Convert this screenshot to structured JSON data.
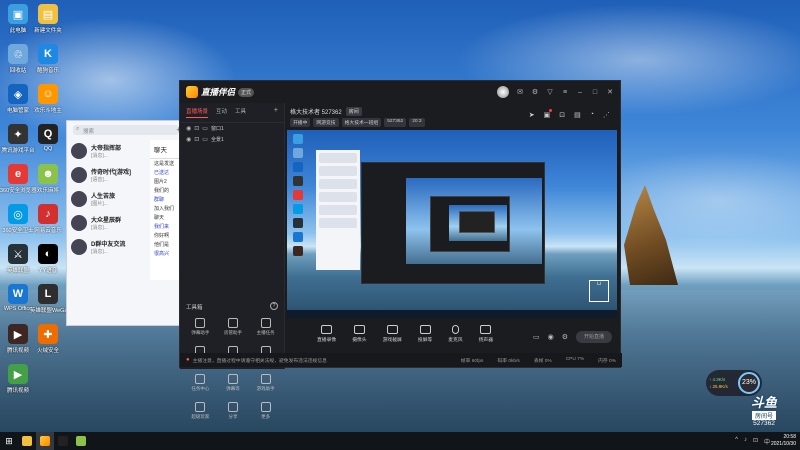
{
  "desktop_icons": [
    {
      "label": "此电脑",
      "color": "#3a9ee0",
      "glyph": "▣"
    },
    {
      "label": "新建文件夹",
      "color": "#f0c040",
      "glyph": "▤"
    },
    {
      "label": "回收站",
      "color": "#6fa8dc",
      "glyph": "♲"
    },
    {
      "label": "酷狗音乐",
      "color": "#1e88e5",
      "glyph": "K"
    },
    {
      "label": "电脑管家",
      "color": "#1565c0",
      "glyph": "◈"
    },
    {
      "label": "欢乐斗地主",
      "color": "#ff9800",
      "glyph": "☺"
    },
    {
      "label": "腾讯游戏平台",
      "color": "#333",
      "glyph": "✦"
    },
    {
      "label": "QQ",
      "color": "#222",
      "glyph": "Q"
    },
    {
      "label": "360安全浏览器",
      "color": "#e53935",
      "glyph": "e"
    },
    {
      "label": "欢乐麻将",
      "color": "#8bc34a",
      "glyph": "☻"
    },
    {
      "label": "360安全卫士",
      "color": "#039be5",
      "glyph": "◎"
    },
    {
      "label": "网易云音乐",
      "color": "#d32f2f",
      "glyph": "♪"
    },
    {
      "label": "英雄联盟",
      "color": "#263238",
      "glyph": "⚔"
    },
    {
      "label": "YY语音",
      "color": "#000",
      "glyph": "◐"
    },
    {
      "label": "WPS Office",
      "color": "#1976d2",
      "glyph": "W"
    },
    {
      "label": "英雄联盟WeGame",
      "color": "#2e2e2e",
      "glyph": "L"
    },
    {
      "label": "腾讯视频",
      "color": "#3e2723",
      "glyph": "▶"
    },
    {
      "label": "火绒安全",
      "color": "#ef6c00",
      "glyph": "✚"
    },
    {
      "label": "腾讯视频",
      "color": "#43a047",
      "glyph": "▶"
    }
  ],
  "chat": {
    "search_placeholder": "搜索",
    "items": [
      {
        "name": "大帝指挥部",
        "msg": "[消息]...",
        "time": "20:53"
      },
      {
        "name": "传奇时代[游戏]",
        "msg": "[语音]...",
        "time": "20:48"
      },
      {
        "name": "人生苦旅",
        "msg": "[图片]...",
        "time": "20:46"
      },
      {
        "name": "大众星辰群",
        "msg": "[消息]...",
        "time": "19:25"
      },
      {
        "name": "D群中友交流",
        "msg": "[消息]...",
        "time": "20:32"
      }
    ],
    "right_title": "聊天",
    "right_lines": [
      "这是发送",
      "已送达",
      "图片2",
      "我们的",
      "群聊",
      "加入我们",
      "聊天",
      "我们来",
      "你好啊",
      "他们是",
      "很高兴"
    ]
  },
  "app": {
    "logo_text": "直播伴侣",
    "version_badge": "正式",
    "tabs": [
      "直播场景",
      "互动",
      "工具"
    ],
    "scenes": [
      "窗口1",
      "全景1"
    ],
    "stream_title": "格大技术者 527362",
    "room_badge": "房间",
    "sub_chips": [
      "开播中",
      "网游竞技",
      "格大技术一班组",
      "527362",
      "20:3"
    ],
    "tools_title": "工具箱",
    "tools": [
      {
        "label": "弹幕助手"
      },
      {
        "label": "房管助手"
      },
      {
        "label": "主播任务"
      },
      {
        "label": "视频直播"
      },
      {
        "label": "多人连麦"
      },
      {
        "label": "抽奖等"
      },
      {
        "label": "任务中心"
      },
      {
        "label": "弹幕等"
      },
      {
        "label": "游戏助手"
      },
      {
        "label": "超级玩家"
      },
      {
        "label": "分享"
      },
      {
        "label": "更多"
      }
    ],
    "bottom_buttons": [
      "直播录像",
      "摄像头",
      "游戏截屏",
      "投屏等",
      "麦克风",
      "扬声器"
    ],
    "start_label": "开始直播",
    "status_warning": "主播注意，直播过程中请遵守相关法规，避免发布违法违规信息",
    "status_stats": [
      "帧率 60fps",
      "码率 0kb/s",
      "丢帧 0%",
      "CPU 7%",
      "内存 0%"
    ]
  },
  "net_widget": {
    "up": "4.3K/s",
    "down": "25.9K/s",
    "percent": "23%"
  },
  "douyu": {
    "brand": "斗鱼",
    "room_label": "房间号",
    "room_number": "527362"
  },
  "taskbar": {
    "time": "20:58",
    "date": "2021/10/30",
    "tray": [
      "^",
      "♪",
      "⊡",
      "中"
    ]
  }
}
